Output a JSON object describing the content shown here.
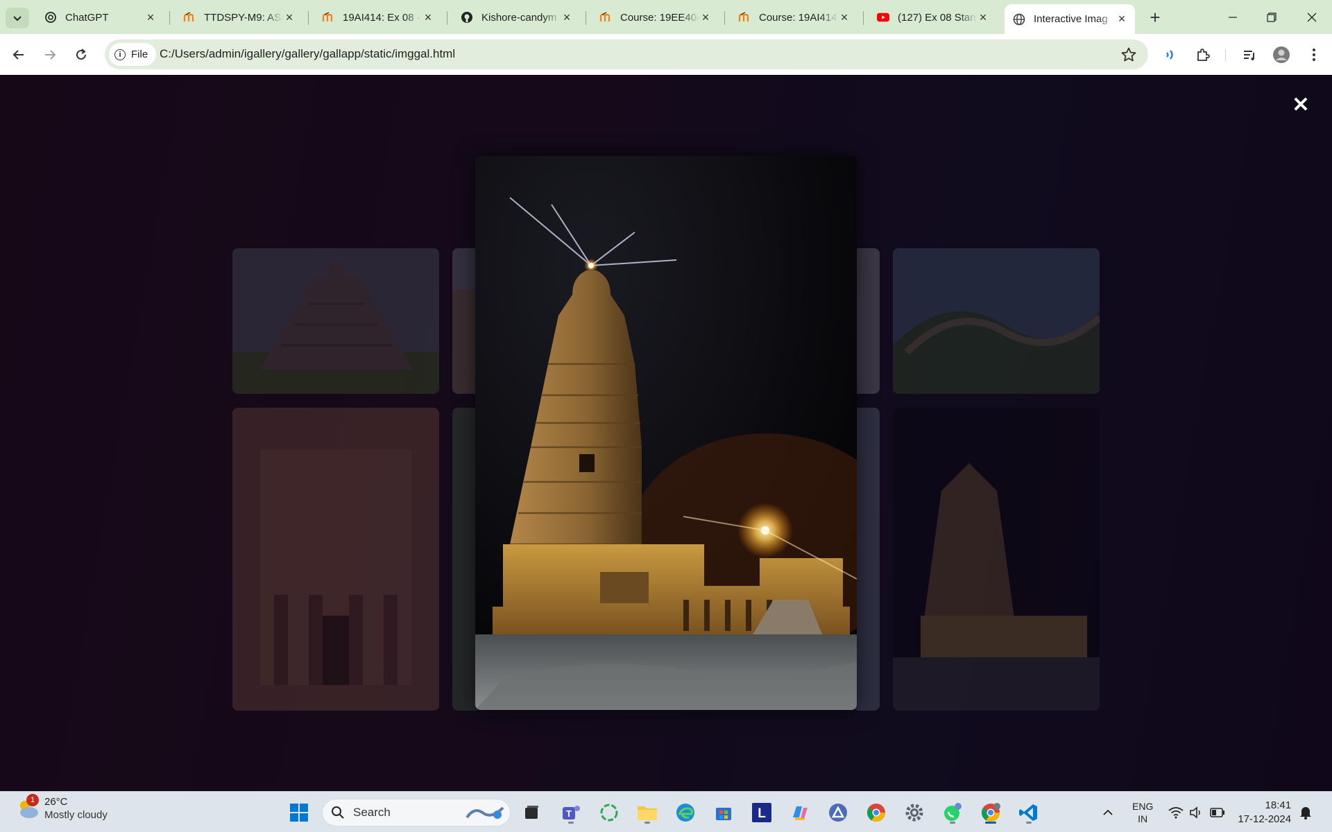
{
  "browser": {
    "tabs": [
      {
        "title": "ChatGPT",
        "icon": "chatgpt-icon"
      },
      {
        "title": "TTDSPY-M9: ASS",
        "icon": "moodle-icon"
      },
      {
        "title": "19AI414: Ex 08 -",
        "icon": "moodle-icon"
      },
      {
        "title": "Kishore-candym",
        "icon": "github-icon"
      },
      {
        "title": "Course: 19EE404",
        "icon": "moodle-icon"
      },
      {
        "title": "Course: 19AI414",
        "icon": "moodle-icon"
      },
      {
        "title": "(127) Ex 08 Stand",
        "icon": "youtube-icon"
      },
      {
        "title": "Interactive Imag",
        "icon": "globe-icon",
        "active": true
      }
    ],
    "address": {
      "scheme_chip": "File",
      "url": "C:/Users/admin/igallery/gallery/gallapp/static/imggal.html"
    }
  },
  "gallery": {
    "close_label": "✕",
    "thumbnails": [
      "pyramid",
      "colosseum",
      "wall",
      "petra",
      "machu",
      "taj",
      "temple"
    ],
    "lightbox_image": "temple-night"
  },
  "taskbar": {
    "weather": {
      "temp": "26°C",
      "condition": "Mostly cloudy",
      "badge": "1"
    },
    "search_placeholder": "Search",
    "tray": {
      "lang": "ENG",
      "region": "IN",
      "time": "18:41",
      "date": "17-12-2024"
    }
  },
  "colors": {
    "tabstrip": "#d9ead3",
    "omnibox": "#e3eddd",
    "page_bg": "#14081a",
    "taskbar": "#dee5ea",
    "accent": "#005fb8"
  }
}
